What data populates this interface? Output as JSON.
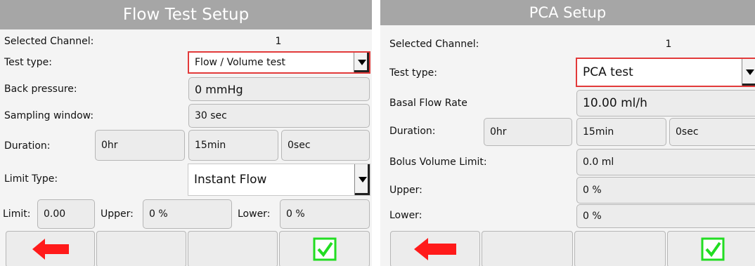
{
  "flow_setup": {
    "title": "Flow Test Setup",
    "selected_channel_label": "Selected Channel:",
    "selected_channel_value": "1",
    "test_type_label": "Test type:",
    "test_type_value": "Flow / Volume test",
    "back_pressure_label": "Back pressure:",
    "back_pressure_value": "0 mmHg",
    "sampling_window_label": "Sampling window:",
    "sampling_window_value": "30 sec",
    "duration_label": "Duration:",
    "duration_hr": "0hr",
    "duration_min": "15min",
    "duration_sec": "0sec",
    "limit_type_label": "Limit Type:",
    "limit_type_value": "Instant Flow",
    "limit_label": "Limit:",
    "limit_value": "0.00",
    "upper_label": "Upper:",
    "upper_value": "0 %",
    "lower_label": "Lower:",
    "lower_value": "0 %"
  },
  "pca_setup": {
    "title": "PCA Setup",
    "selected_channel_label": "Selected Channel:",
    "selected_channel_value": "1",
    "test_type_label": "Test type:",
    "test_type_value": "PCA test",
    "basal_flow_label": "Basal Flow Rate",
    "basal_flow_value": "10.00  ml/h",
    "duration_label": "Duration:",
    "duration_hr": "0hr",
    "duration_min": "15min",
    "duration_sec": "0sec",
    "bolus_limit_label": "Bolus Volume Limit:",
    "bolus_limit_value": "0.0 ml",
    "upper_label": "Upper:",
    "upper_value": "0 %",
    "lower_label": "Lower:",
    "lower_value": "0 %"
  },
  "icons": {
    "back": "red-left-arrow",
    "confirm": "green-checkbox"
  },
  "colors": {
    "title_bar": "#a6a6a6",
    "active_border": "#e23a3a",
    "back_arrow": "#ff1a1a",
    "confirm_check": "#22dd22"
  }
}
